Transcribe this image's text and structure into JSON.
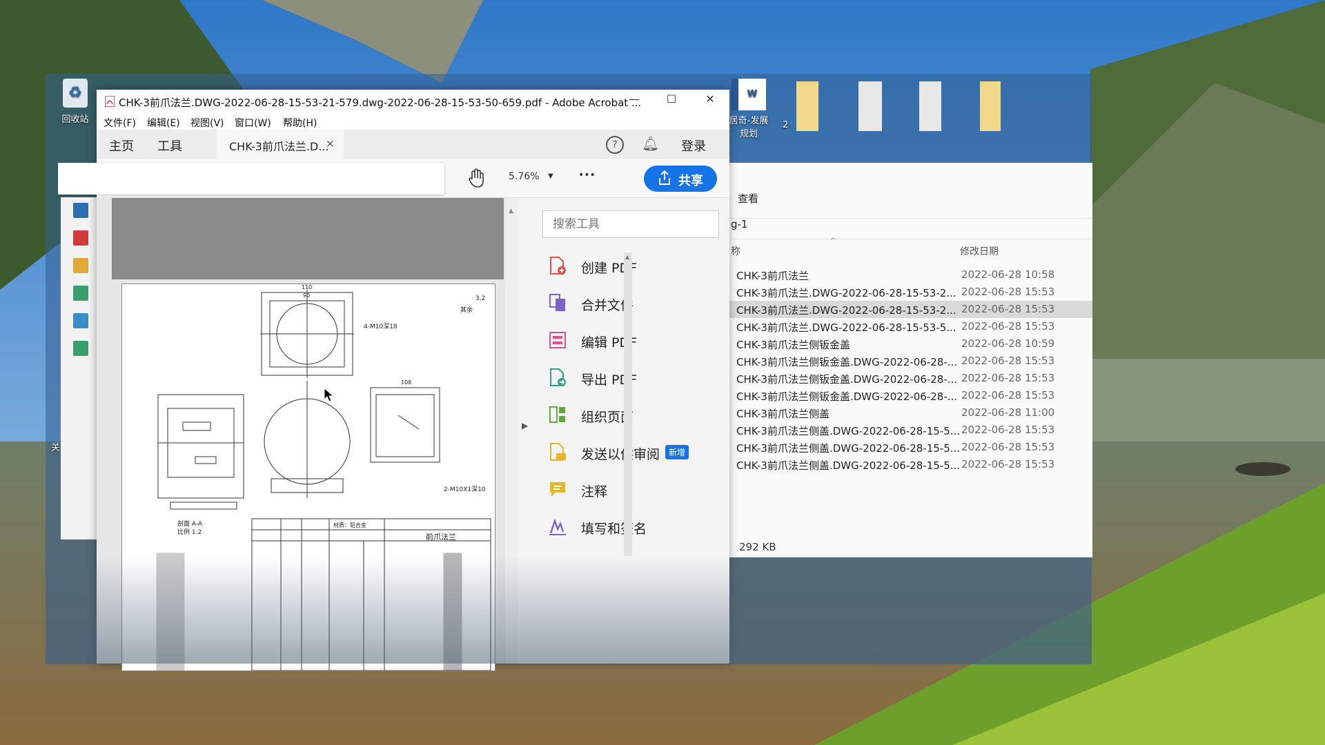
{
  "desktop": {
    "recycle_bin_label": "回收站",
    "word_doc_label_line1": "居奇-发展",
    "word_doc_label_line2": "规划",
    "fragment_2": "2",
    "fragment_qian": "关"
  },
  "acrobat": {
    "title": "CHK-3前爪法兰.DWG-2022-06-28-15-53-21-579.dwg-2022-06-28-15-53-50-659.pdf - Adobe Acrobat ...",
    "menu": [
      "文件(F)",
      "编辑(E)",
      "视图(V)",
      "窗口(W)",
      "帮助(H)"
    ],
    "nav_home": "主页",
    "nav_tools": "工具",
    "doc_tab_label": "CHK-3前爪法兰.D...",
    "doc_tab_close": "×",
    "help": "?",
    "login": "登录",
    "zoom": "5.76%",
    "more": "•••",
    "share": "共享",
    "search_placeholder": "搜索工具",
    "tools": [
      {
        "label": "创建 PDF",
        "color": "#e5504b"
      },
      {
        "label": "合并文件",
        "color": "#7a64c8"
      },
      {
        "label": "编辑 PDF",
        "color": "#e14f8b"
      },
      {
        "label": "导出 PDF",
        "color": "#2ea386"
      },
      {
        "label": "组织页面",
        "color": "#62a83b"
      },
      {
        "label": "发送以供审阅",
        "color": "#e8b627"
      },
      {
        "label": "注释",
        "color": "#e8b627"
      },
      {
        "label": "填写和签名",
        "color": "#7a64c8"
      }
    ],
    "new_badge": "新增",
    "drawing": {
      "note_right": "其余",
      "roughness": "3.2",
      "label_4m10": "4-M10深18",
      "label_2m10": "2-M10X1深10",
      "dim_top": "110",
      "dim_top2": "90",
      "dim_right": "108",
      "section": "剖面 A-A",
      "scale": "比例 1:2",
      "title_block": "前爪法兰",
      "material": "材质：铝合金"
    }
  },
  "explorer": {
    "view_tab": "查看",
    "path_fragment": "g-1",
    "col_name": "称",
    "col_date": "修改日期",
    "rows": [
      {
        "name": "CHK-3前爪法兰",
        "date": "2022-06-28 10:58"
      },
      {
        "name": "CHK-3前爪法兰.DWG-2022-06-28-15-53-2...",
        "date": "2022-06-28 15:53"
      },
      {
        "name": "CHK-3前爪法兰.DWG-2022-06-28-15-53-2...",
        "date": "2022-06-28 15:53",
        "selected": true
      },
      {
        "name": "CHK-3前爪法兰.DWG-2022-06-28-15-53-5...",
        "date": "2022-06-28 15:53"
      },
      {
        "name": "CHK-3前爪法兰侧钣金盖",
        "date": "2022-06-28 10:59"
      },
      {
        "name": "CHK-3前爪法兰侧钣金盖.DWG-2022-06-28-...",
        "date": "2022-06-28 15:53"
      },
      {
        "name": "CHK-3前爪法兰侧钣金盖.DWG-2022-06-28-...",
        "date": "2022-06-28 15:53"
      },
      {
        "name": "CHK-3前爪法兰侧钣金盖.DWG-2022-06-28-...",
        "date": "2022-06-28 15:53"
      },
      {
        "name": "CHK-3前爪法兰侧盖",
        "date": "2022-06-28 11:00"
      },
      {
        "name": "CHK-3前爪法兰侧盖.DWG-2022-06-28-15-5...",
        "date": "2022-06-28 15:53"
      },
      {
        "name": "CHK-3前爪法兰侧盖.DWG-2022-06-28-15-5...",
        "date": "2022-06-28 15:53"
      },
      {
        "name": "CHK-3前爪法兰侧盖.DWG-2022-06-28-15-5...",
        "date": "2022-06-28 15:53"
      }
    ],
    "size": "292 KB"
  }
}
